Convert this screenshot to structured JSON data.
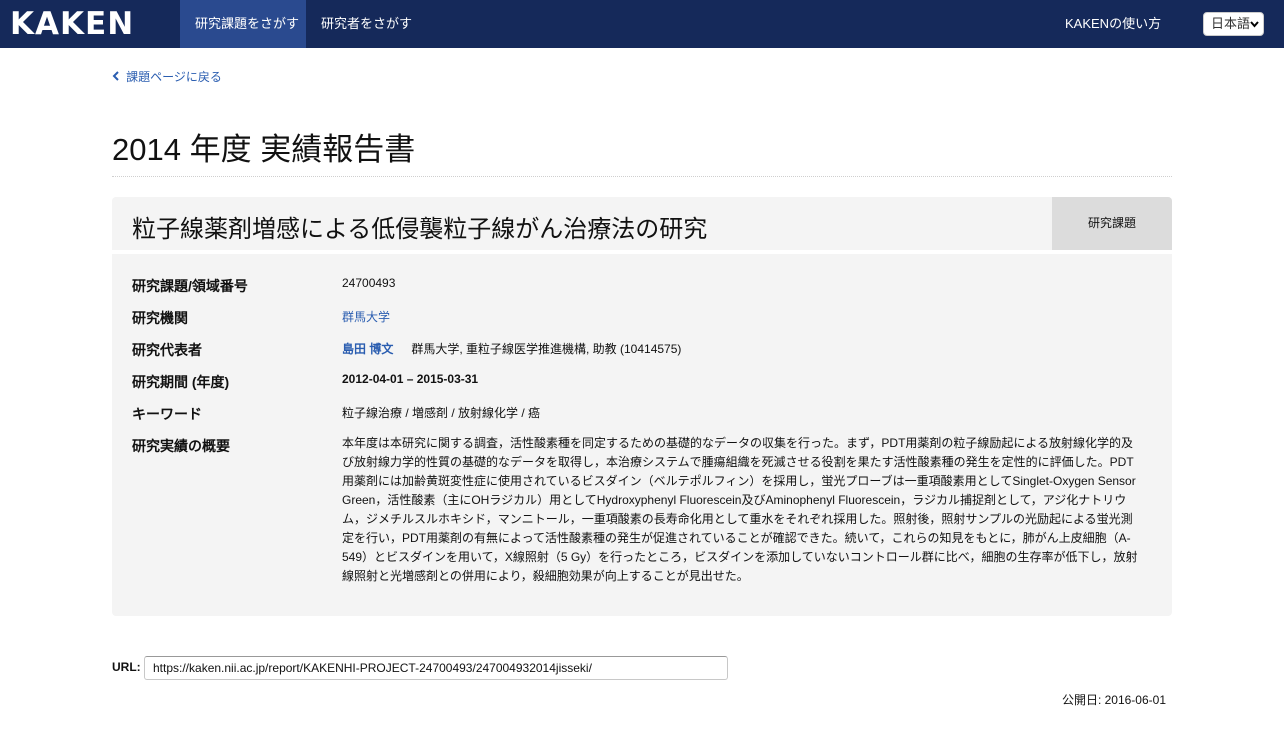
{
  "nav": {
    "logo": "KAKEN",
    "search_projects": "研究課題をさがす",
    "search_researchers": "研究者をさがす",
    "help": "KAKENの使い方",
    "language": "日本語"
  },
  "back_link": "課題ページに戻る",
  "page_title": "2014 年度 実績報告書",
  "project": {
    "title": "粒子線薬剤増感による低侵襲粒子線がん治療法の研究",
    "badge": "研究課題"
  },
  "details": {
    "number_label": "研究課題/領域番号",
    "number_value": "24700493",
    "institution_label": "研究機関",
    "institution_value": "群馬大学",
    "representative_label": "研究代表者",
    "representative_name": "島田 博文",
    "representative_affiliation": "群馬大学, 重粒子線医学推進機構, 助教 (10414575)",
    "period_label": "研究期間 (年度)",
    "period_value": "2012-04-01 – 2015-03-31",
    "keywords_label": "キーワード",
    "keywords_value": "粒子線治療 / 増感剤 / 放射線化学 / 癌",
    "summary_label": "研究実績の概要",
    "summary_value": "本年度は本研究に関する調査，活性酸素種を同定するための基礎的なデータの収集を行った。まず，PDT用薬剤の粒子線励起による放射線化学的及び放射線力学的性質の基礎的なデータを取得し，本治療システムで腫瘍組織を死滅させる役割を果たす活性酸素種の発生を定性的に評価した。PDT用薬剤には加齢黄斑変性症に使用されているビスダイン（ベルテポルフィン）を採用し，蛍光プローブは一重項酸素用としてSinglet-Oxygen Sensor Green，活性酸素（主にOHラジカル）用としてHydroxyphenyl Fluorescein及びAminophenyl Fluorescein，ラジカル捕捉剤として，アジ化ナトリウム，ジメチルスルホキシド，マンニトール，一重項酸素の長寿命化用として重水をそれぞれ採用した。照射後，照射サンプルの光励起による蛍光測定を行い，PDT用薬剤の有無によって活性酸素種の発生が促進されていることが確認できた。続いて，これらの知見をもとに，肺がん上皮細胞（A-549）とビスダインを用いて，X線照射（5 Gy）を行ったところ，ビスダインを添加していないコントロール群に比べ，細胞の生存率が低下し，放射線照射と光増感剤との併用により，殺細胞効果が向上することが見出せた。"
  },
  "url": {
    "label": "URL:",
    "value": "https://kaken.nii.ac.jp/report/KAKENHI-PROJECT-24700493/247004932014jisseki/"
  },
  "published": "公開日: 2016-06-01"
}
